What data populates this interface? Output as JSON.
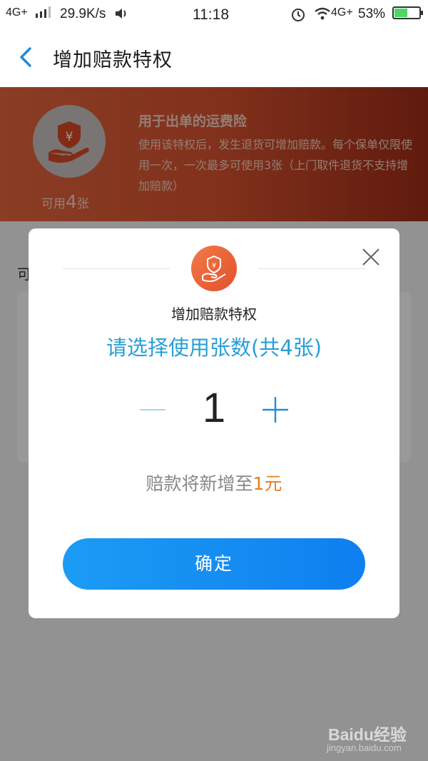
{
  "status_bar": {
    "network_left": "4G+",
    "speed": "29.9K/s",
    "time": "11:18",
    "network_right": "4G+",
    "battery_percent": "53%"
  },
  "nav": {
    "title": "增加赔款特权",
    "back_icon": "chevron-left-icon"
  },
  "banner": {
    "title": "用于出单的运费险",
    "description": "使用该特权后，发生退货可增加赔款。每个保单仅限使用一次，一次最多可使用3张（上门取件退货不支持增加赔款）",
    "available_prefix": "可用",
    "available_count": "4",
    "available_suffix": "张",
    "icon": "yuan-shield-hand-icon"
  },
  "background": {
    "peek_text": "可"
  },
  "dialog": {
    "subtitle": "增加赔款特权",
    "heading": "请选择使用张数(共4张)",
    "quantity": "1",
    "payout_prefix": "赔款将新增至",
    "payout_amount": "1元",
    "confirm_label": "确定",
    "close_icon": "close-icon"
  },
  "watermark": {
    "logo": "Baidu经验",
    "url": "jingyan.baidu.com"
  },
  "colors": {
    "accent": "#2a9fd6",
    "button": "#1b9cf4",
    "amount": "#e67e22",
    "banner": "#d9532f"
  }
}
